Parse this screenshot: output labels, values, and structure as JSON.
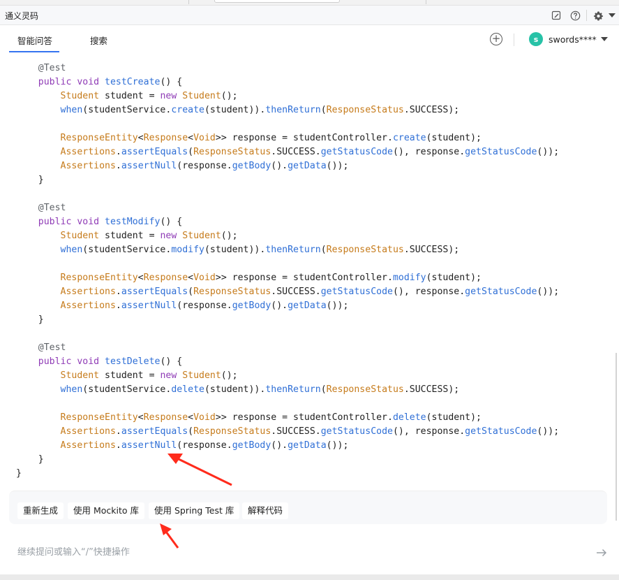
{
  "window": {
    "title": "通义灵码"
  },
  "tabs": [
    {
      "label": "智能问答",
      "active": true
    },
    {
      "label": "搜索",
      "active": false
    }
  ],
  "user": {
    "avatar_initial": "s",
    "name": "swords****"
  },
  "code_lines": [
    [
      [
        "a",
        "    @Test"
      ]
    ],
    [
      [
        "k",
        "    public "
      ],
      [
        "k",
        "void "
      ],
      [
        "m",
        "testCreate"
      ],
      [
        "p",
        "() {"
      ]
    ],
    [
      [
        "t",
        "        Student "
      ],
      [
        "p",
        "student = "
      ],
      [
        "k",
        "new "
      ],
      [
        "t",
        "Student"
      ],
      [
        "p",
        "();"
      ]
    ],
    [
      [
        "m",
        "        when"
      ],
      [
        "p",
        "(studentService."
      ],
      [
        "m",
        "create"
      ],
      [
        "p",
        "(student))."
      ],
      [
        "m",
        "thenReturn"
      ],
      [
        "p",
        "("
      ],
      [
        "t",
        "ResponseStatus"
      ],
      [
        "p",
        ".SUCCESS);"
      ]
    ],
    [
      [
        "p",
        ""
      ]
    ],
    [
      [
        "t",
        "        ResponseEntity"
      ],
      [
        "p",
        "<"
      ],
      [
        "t",
        "Response"
      ],
      [
        "p",
        "<"
      ],
      [
        "t",
        "Void"
      ],
      [
        "p",
        ">> response = studentController."
      ],
      [
        "m",
        "create"
      ],
      [
        "p",
        "(student);"
      ]
    ],
    [
      [
        "t",
        "        Assertions"
      ],
      [
        "p",
        "."
      ],
      [
        "m",
        "assertEquals"
      ],
      [
        "p",
        "("
      ],
      [
        "t",
        "ResponseStatus"
      ],
      [
        "p",
        ".SUCCESS."
      ],
      [
        "m",
        "getStatusCode"
      ],
      [
        "p",
        "(), response."
      ],
      [
        "m",
        "getStatusCode"
      ],
      [
        "p",
        "());"
      ]
    ],
    [
      [
        "t",
        "        Assertions"
      ],
      [
        "p",
        "."
      ],
      [
        "m",
        "assertNull"
      ],
      [
        "p",
        "(response."
      ],
      [
        "m",
        "getBody"
      ],
      [
        "p",
        "()."
      ],
      [
        "m",
        "getData"
      ],
      [
        "p",
        "());"
      ]
    ],
    [
      [
        "p",
        "    }"
      ]
    ],
    [
      [
        "p",
        ""
      ]
    ],
    [
      [
        "a",
        "    @Test"
      ]
    ],
    [
      [
        "k",
        "    public "
      ],
      [
        "k",
        "void "
      ],
      [
        "m",
        "testModify"
      ],
      [
        "p",
        "() {"
      ]
    ],
    [
      [
        "t",
        "        Student "
      ],
      [
        "p",
        "student = "
      ],
      [
        "k",
        "new "
      ],
      [
        "t",
        "Student"
      ],
      [
        "p",
        "();"
      ]
    ],
    [
      [
        "m",
        "        when"
      ],
      [
        "p",
        "(studentService."
      ],
      [
        "m",
        "modify"
      ],
      [
        "p",
        "(student))."
      ],
      [
        "m",
        "thenReturn"
      ],
      [
        "p",
        "("
      ],
      [
        "t",
        "ResponseStatus"
      ],
      [
        "p",
        ".SUCCESS);"
      ]
    ],
    [
      [
        "p",
        ""
      ]
    ],
    [
      [
        "t",
        "        ResponseEntity"
      ],
      [
        "p",
        "<"
      ],
      [
        "t",
        "Response"
      ],
      [
        "p",
        "<"
      ],
      [
        "t",
        "Void"
      ],
      [
        "p",
        ">> response = studentController."
      ],
      [
        "m",
        "modify"
      ],
      [
        "p",
        "(student);"
      ]
    ],
    [
      [
        "t",
        "        Assertions"
      ],
      [
        "p",
        "."
      ],
      [
        "m",
        "assertEquals"
      ],
      [
        "p",
        "("
      ],
      [
        "t",
        "ResponseStatus"
      ],
      [
        "p",
        ".SUCCESS."
      ],
      [
        "m",
        "getStatusCode"
      ],
      [
        "p",
        "(), response."
      ],
      [
        "m",
        "getStatusCode"
      ],
      [
        "p",
        "());"
      ]
    ],
    [
      [
        "t",
        "        Assertions"
      ],
      [
        "p",
        "."
      ],
      [
        "m",
        "assertNull"
      ],
      [
        "p",
        "(response."
      ],
      [
        "m",
        "getBody"
      ],
      [
        "p",
        "()."
      ],
      [
        "m",
        "getData"
      ],
      [
        "p",
        "());"
      ]
    ],
    [
      [
        "p",
        "    }"
      ]
    ],
    [
      [
        "p",
        ""
      ]
    ],
    [
      [
        "a",
        "    @Test"
      ]
    ],
    [
      [
        "k",
        "    public "
      ],
      [
        "k",
        "void "
      ],
      [
        "m",
        "testDelete"
      ],
      [
        "p",
        "() {"
      ]
    ],
    [
      [
        "t",
        "        Student "
      ],
      [
        "p",
        "student = "
      ],
      [
        "k",
        "new "
      ],
      [
        "t",
        "Student"
      ],
      [
        "p",
        "();"
      ]
    ],
    [
      [
        "m",
        "        when"
      ],
      [
        "p",
        "(studentService."
      ],
      [
        "m",
        "delete"
      ],
      [
        "p",
        "(student))."
      ],
      [
        "m",
        "thenReturn"
      ],
      [
        "p",
        "("
      ],
      [
        "t",
        "ResponseStatus"
      ],
      [
        "p",
        ".SUCCESS);"
      ]
    ],
    [
      [
        "p",
        ""
      ]
    ],
    [
      [
        "t",
        "        ResponseEntity"
      ],
      [
        "p",
        "<"
      ],
      [
        "t",
        "Response"
      ],
      [
        "p",
        "<"
      ],
      [
        "t",
        "Void"
      ],
      [
        "p",
        ">> response = studentController."
      ],
      [
        "m",
        "delete"
      ],
      [
        "p",
        "(student);"
      ]
    ],
    [
      [
        "t",
        "        Assertions"
      ],
      [
        "p",
        "."
      ],
      [
        "m",
        "assertEquals"
      ],
      [
        "p",
        "("
      ],
      [
        "t",
        "ResponseStatus"
      ],
      [
        "p",
        ".SUCCESS."
      ],
      [
        "m",
        "getStatusCode"
      ],
      [
        "p",
        "(), response."
      ],
      [
        "m",
        "getStatusCode"
      ],
      [
        "p",
        "());"
      ]
    ],
    [
      [
        "t",
        "        Assertions"
      ],
      [
        "p",
        "."
      ],
      [
        "m",
        "assertNull"
      ],
      [
        "p",
        "(response."
      ],
      [
        "m",
        "getBody"
      ],
      [
        "p",
        "()."
      ],
      [
        "m",
        "getData"
      ],
      [
        "p",
        "());"
      ]
    ],
    [
      [
        "p",
        "    }"
      ]
    ],
    [
      [
        "p",
        "}"
      ]
    ]
  ],
  "actions": {
    "regenerate": "重新生成",
    "use_mockito": "使用 Mockito 库",
    "use_spring_test": "使用 Spring Test 库",
    "explain_code": "解释代码"
  },
  "input": {
    "placeholder": "继续提问或输入“/”快捷操作"
  },
  "icons": {
    "edit": "edit-icon",
    "help": "help-icon",
    "settings": "gear-icon",
    "new_chat": "plus-circle-icon",
    "dropdown": "chevron-down-icon",
    "send": "arrow-right-icon"
  },
  "colors": {
    "keyword": "#8f3bb6",
    "type": "#c67b1b",
    "method": "#2f6fd6",
    "annotation": "#5f6368",
    "accent": "#3574f0",
    "avatar": "#27c2a7",
    "arrow": "#ff2b1c"
  }
}
